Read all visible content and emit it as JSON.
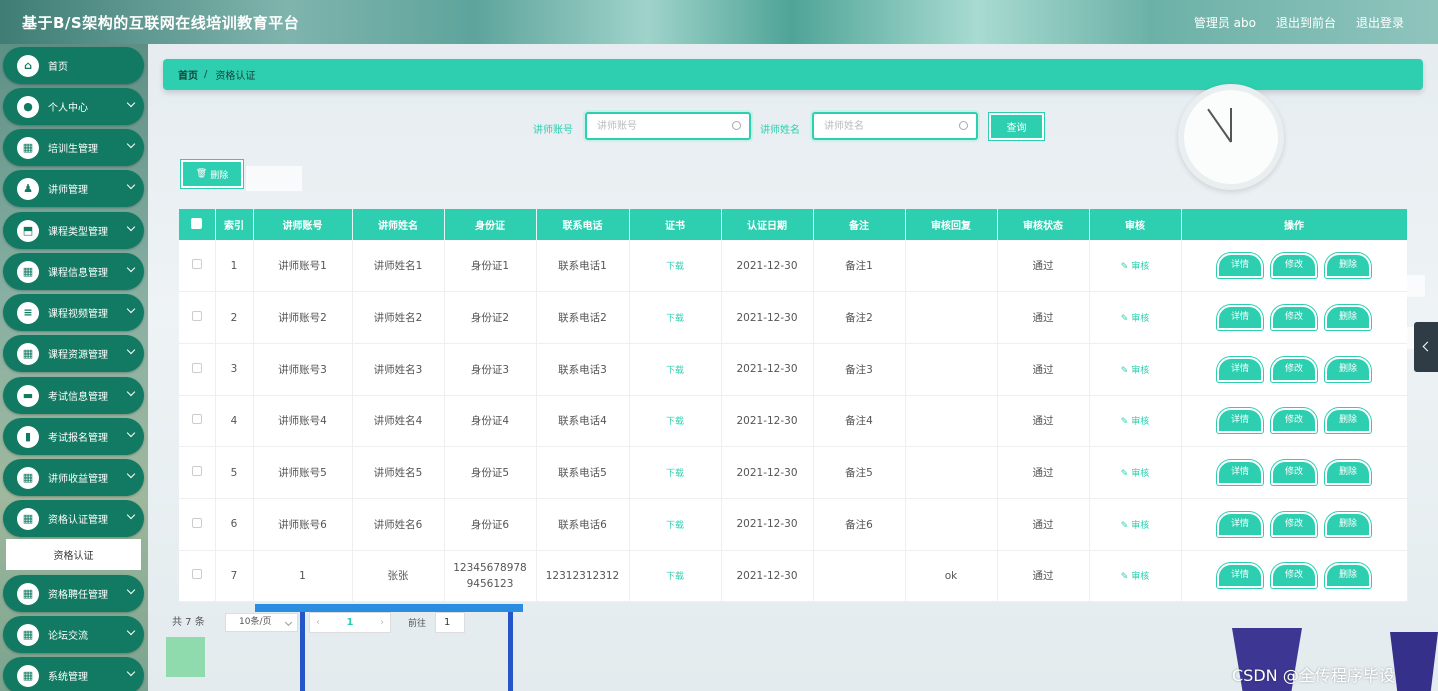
{
  "header": {
    "title": "基于B/S架构的互联网在线培训教育平台",
    "user": "管理员 abo",
    "to_front": "退出到前台",
    "logout": "退出登录"
  },
  "sidebar": {
    "items": [
      {
        "label": "首页",
        "icon": "home-icon"
      },
      {
        "label": "个人中心",
        "icon": "user-icon"
      },
      {
        "label": "培训生管理",
        "icon": "grid-icon"
      },
      {
        "label": "讲师管理",
        "icon": "person-icon"
      },
      {
        "label": "课程类型管理",
        "icon": "tag-icon"
      },
      {
        "label": "课程信息管理",
        "icon": "grid-icon"
      },
      {
        "label": "课程视频管理",
        "icon": "list-icon"
      },
      {
        "label": "课程资源管理",
        "icon": "grid-icon"
      },
      {
        "label": "考试信息管理",
        "icon": "chat-icon"
      },
      {
        "label": "考试报名管理",
        "icon": "book-icon"
      },
      {
        "label": "讲师收益管理",
        "icon": "grid-icon"
      },
      {
        "label": "资格认证管理",
        "icon": "grid-icon"
      },
      {
        "label": "资格聘任管理",
        "icon": "grid-icon"
      },
      {
        "label": "论坛交流",
        "icon": "grid-icon"
      },
      {
        "label": "系统管理",
        "icon": "grid-icon"
      }
    ],
    "submenu_active": "资格认证"
  },
  "breadcrumb": {
    "home": "首页",
    "sep": "/",
    "current": "资格认证"
  },
  "search": {
    "account_label": "讲师账号",
    "account_placeholder": "讲师账号",
    "name_label": "讲师姓名",
    "name_placeholder": "讲师姓名",
    "query_button": "查询"
  },
  "toolbar": {
    "delete_label": "删除",
    "delete_icon": "trash-icon"
  },
  "table": {
    "headers": [
      "索引",
      "讲师账号",
      "讲师姓名",
      "身份证",
      "联系电话",
      "证书",
      "认证日期",
      "备注",
      "审核回复",
      "审核状态",
      "审核",
      "操作"
    ],
    "rows": [
      {
        "index": "1",
        "account": "讲师账号1",
        "name": "讲师姓名1",
        "idcard": "身份证1",
        "phone": "联系电话1",
        "cert": "下载",
        "date": "2021-12-30",
        "note": "备注1",
        "reply": "",
        "status": "通过",
        "audit": "审核"
      },
      {
        "index": "2",
        "account": "讲师账号2",
        "name": "讲师姓名2",
        "idcard": "身份证2",
        "phone": "联系电话2",
        "cert": "下载",
        "date": "2021-12-30",
        "note": "备注2",
        "reply": "",
        "status": "通过",
        "audit": "审核"
      },
      {
        "index": "3",
        "account": "讲师账号3",
        "name": "讲师姓名3",
        "idcard": "身份证3",
        "phone": "联系电话3",
        "cert": "下载",
        "date": "2021-12-30",
        "note": "备注3",
        "reply": "",
        "status": "通过",
        "audit": "审核"
      },
      {
        "index": "4",
        "account": "讲师账号4",
        "name": "讲师姓名4",
        "idcard": "身份证4",
        "phone": "联系电话4",
        "cert": "下载",
        "date": "2021-12-30",
        "note": "备注4",
        "reply": "",
        "status": "通过",
        "audit": "审核"
      },
      {
        "index": "5",
        "account": "讲师账号5",
        "name": "讲师姓名5",
        "idcard": "身份证5",
        "phone": "联系电话5",
        "cert": "下载",
        "date": "2021-12-30",
        "note": "备注5",
        "reply": "",
        "status": "通过",
        "audit": "审核"
      },
      {
        "index": "6",
        "account": "讲师账号6",
        "name": "讲师姓名6",
        "idcard": "身份证6",
        "phone": "联系电话6",
        "cert": "下载",
        "date": "2021-12-30",
        "note": "备注6",
        "reply": "",
        "status": "通过",
        "audit": "审核"
      },
      {
        "index": "7",
        "account": "1",
        "name": "张张",
        "idcard": "123456789789456123",
        "phone": "12312312312",
        "cert": "下载",
        "date": "2021-12-30",
        "note": "",
        "reply": "ok",
        "status": "通过",
        "audit": "审核"
      }
    ],
    "actions": {
      "detail": "详情",
      "edit": "修改",
      "delete": "删除"
    }
  },
  "pagination": {
    "total": "共 7 条",
    "page_size": "10条/页",
    "current_page": "1",
    "goto_label": "前往",
    "goto_value": "1"
  },
  "watermark": "CSDN @全传程序毕设",
  "colors": {
    "accent": "#2ecfb0",
    "sidebar_item": "#127a62"
  }
}
